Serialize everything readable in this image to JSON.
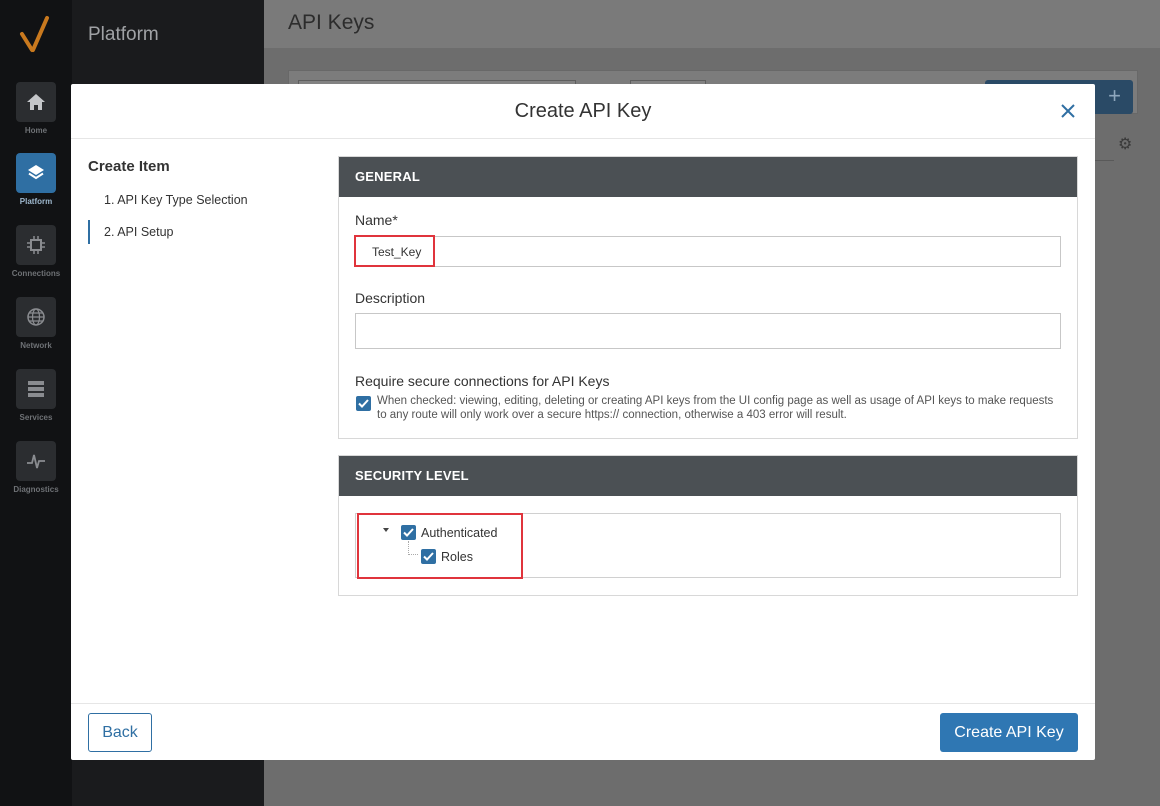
{
  "rail": {
    "items": [
      {
        "label": "Home",
        "icon": "home-icon"
      },
      {
        "label": "Platform",
        "icon": "layers-icon"
      },
      {
        "label": "Connections",
        "icon": "connections-icon"
      },
      {
        "label": "Network",
        "icon": "globe-icon"
      },
      {
        "label": "Services",
        "icon": "server-icon"
      },
      {
        "label": "Diagnostics",
        "icon": "pulse-icon"
      }
    ]
  },
  "sidebar": {
    "title": "Platform"
  },
  "page": {
    "title": "API Keys"
  },
  "modal": {
    "title": "Create API Key",
    "steps_title": "Create Item",
    "steps": [
      "1. API Key Type Selection",
      "2. API Setup"
    ],
    "general": {
      "header": "GENERAL",
      "name_label": "Name*",
      "name_value": "Test_Key",
      "description_label": "Description",
      "description_value": "",
      "secure_label": "Require secure connections for API Keys",
      "secure_checked": true,
      "secure_help": "When checked: viewing, editing, deleting or creating API keys from the UI config page as well as usage of API keys to make requests to any route will only work over a secure https:// connection, otherwise a 403 error will result."
    },
    "security": {
      "header": "SECURITY LEVEL",
      "tree": [
        {
          "label": "Authenticated",
          "checked": true
        },
        {
          "label": "Roles",
          "checked": true
        }
      ]
    },
    "footer": {
      "back_label": "Back",
      "create_label": "Create API Key"
    }
  },
  "colors": {
    "accent": "#2f77b3",
    "panel_header": "#4b5054",
    "highlight": "#e0343c"
  }
}
